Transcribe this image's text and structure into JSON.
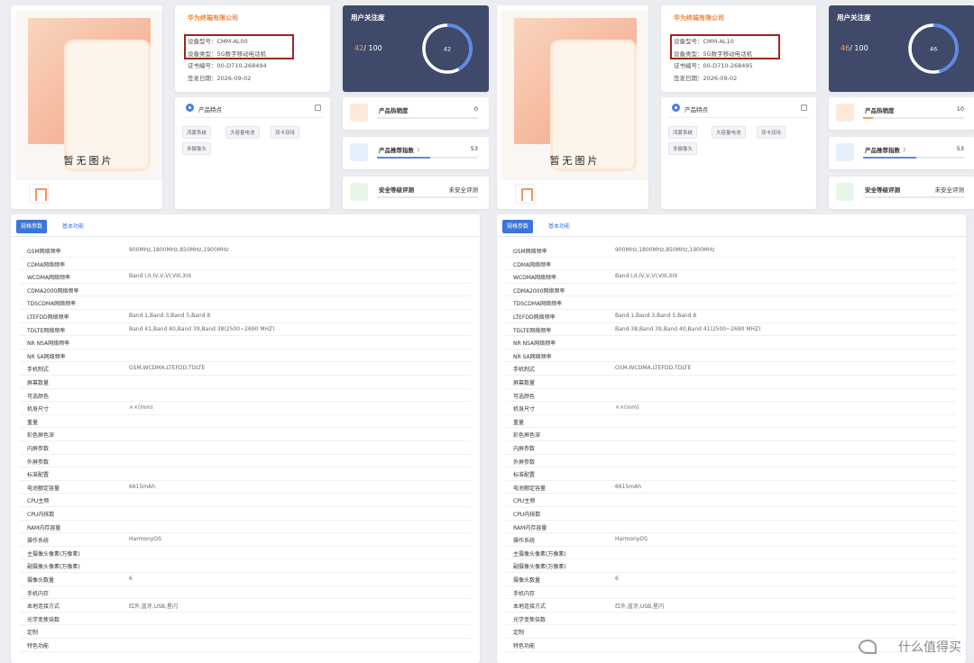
{
  "watermark": "什么值得买",
  "colors": {
    "accent": "#e8843f",
    "highlight_box": "#a3241e",
    "dark_card": "#3f4a6b",
    "ring": "#5b8ae8",
    "tab_active": "#3b76db"
  },
  "panels": [
    {
      "no_image_text": "暂无图片",
      "company": "华为终端有限公司",
      "device_model": "设备型号：CMM-AL00",
      "device_type": "设备类型：5G数字移动电话机",
      "cert_no": "证书编号：00-D710-268494",
      "issue_date": "签发日期：2026-09-02",
      "features_title": "产品特点",
      "feature_tags": [
        "鸿蒙系统",
        "大容量电池",
        "双卡双待",
        "多摄像头"
      ],
      "attention_title": "用户关注度",
      "attention_value": "42",
      "attention_max": "/ 100",
      "attention_ring_label": "42",
      "attention_fraction": 0.42,
      "metrics": [
        {
          "label": "产品热销度",
          "value": "0",
          "icon": "vibrate-phone-icon",
          "fraction": 0.0
        },
        {
          "label": "产品推荐指数",
          "value": "53",
          "icon": "thumbs-up-icon",
          "fraction": 0.53,
          "help": "?"
        },
        {
          "label": "安全等级评测",
          "value": "未安全评测",
          "icon": "shield-icon",
          "fraction": 0
        }
      ],
      "tabs": [
        "规格参数",
        "基本功能"
      ],
      "params": [
        {
          "label": "GSM网络频率",
          "value": "900MHz,1800MHz,850MHz,1900MHz"
        },
        {
          "label": "CDMA网络频率",
          "value": ""
        },
        {
          "label": "WCDMA网络频率",
          "value": "Band I,II,IV,V,VI,VIII,XIX"
        },
        {
          "label": "CDMA2000网络频率",
          "value": ""
        },
        {
          "label": "TDSCDMA网络频率",
          "value": ""
        },
        {
          "label": "LTEFDD网络频率",
          "value": "Band 1,Band 3,Band 5,Band 8"
        },
        {
          "label": "TDLTE网络频率",
          "value": "Band 41,Band 40,Band 39,Band 38(2500~2690 MHZ)"
        },
        {
          "label": "NR NSA网络频率",
          "value": ""
        },
        {
          "label": "NR SA网络频率",
          "value": ""
        },
        {
          "label": "手机制式",
          "value": "GSM,WCDMA,LTEFDD,TDLTE"
        },
        {
          "label": "屏幕数量",
          "value": ""
        },
        {
          "label": "可选颜色",
          "value": ""
        },
        {
          "label": "机身尺寸",
          "value": "××(mm)"
        },
        {
          "label": "重量",
          "value": ""
        },
        {
          "label": "彩色屏色深",
          "value": ""
        },
        {
          "label": "内屏参数",
          "value": ""
        },
        {
          "label": "外屏参数",
          "value": ""
        },
        {
          "label": "标准配置",
          "value": ""
        },
        {
          "label": "电池额定容量",
          "value": "6615mAh"
        },
        {
          "label": "CPU主频",
          "value": ""
        },
        {
          "label": "CPU内核数",
          "value": ""
        },
        {
          "label": "RAM内存容量",
          "value": ""
        },
        {
          "label": "操作系统",
          "value": "HarmonyOS"
        },
        {
          "label": "主摄像头像素(万像素)",
          "value": ""
        },
        {
          "label": "副摄像头像素(万像素)",
          "value": ""
        },
        {
          "label": "摄像头数量",
          "value": "6"
        },
        {
          "label": "手机内存",
          "value": ""
        },
        {
          "label": "本地连接方式",
          "value": "红外,蓝牙,USB,星闪"
        },
        {
          "label": "光学变焦倍数",
          "value": ""
        },
        {
          "label": "定制",
          "value": ""
        },
        {
          "label": "特色功能",
          "value": ""
        }
      ]
    },
    {
      "no_image_text": "暂无图片",
      "company": "华为终端有限公司",
      "device_model": "设备型号：CMM-AL10",
      "device_type": "设备类型：5G数字移动电话机",
      "cert_no": "证书编号：00-D710-268495",
      "issue_date": "签发日期：2026-09-02",
      "features_title": "产品特点",
      "feature_tags": [
        "鸿蒙系统",
        "大容量电池",
        "双卡双待",
        "多摄像头"
      ],
      "attention_title": "用户关注度",
      "attention_value": "46",
      "attention_max": "/ 100",
      "attention_ring_label": "46",
      "attention_fraction": 0.46,
      "metrics": [
        {
          "label": "产品热销度",
          "value": "10",
          "icon": "vibrate-phone-icon",
          "fraction": 0.1
        },
        {
          "label": "产品推荐指数",
          "value": "53",
          "icon": "thumbs-up-icon",
          "fraction": 0.53,
          "help": "?"
        },
        {
          "label": "安全等级评测",
          "value": "未安全评测",
          "icon": "shield-icon",
          "fraction": 0
        }
      ],
      "tabs": [
        "规格参数",
        "基本功能"
      ],
      "params": [
        {
          "label": "GSM网络频率",
          "value": "900MHz,1800MHz,850MHz,1900MHz"
        },
        {
          "label": "CDMA网络频率",
          "value": ""
        },
        {
          "label": "WCDMA网络频率",
          "value": "Band I,II,IV,V,VI,VIII,XIX"
        },
        {
          "label": "CDMA2000网络频率",
          "value": ""
        },
        {
          "label": "TDSCDMA网络频率",
          "value": ""
        },
        {
          "label": "LTEFDD网络频率",
          "value": "Band 1,Band 3,Band 5,Band 8"
        },
        {
          "label": "TDLTE网络频率",
          "value": "Band 38,Band 39,Band 40,Band 41(2500~2690 MHZ)"
        },
        {
          "label": "NR NSA网络频率",
          "value": ""
        },
        {
          "label": "NR SA网络频率",
          "value": ""
        },
        {
          "label": "手机制式",
          "value": "GSM,WCDMA,LTEFDD,TDLTE"
        },
        {
          "label": "屏幕数量",
          "value": ""
        },
        {
          "label": "可选颜色",
          "value": ""
        },
        {
          "label": "机身尺寸",
          "value": "××(mm)"
        },
        {
          "label": "重量",
          "value": ""
        },
        {
          "label": "彩色屏色深",
          "value": ""
        },
        {
          "label": "内屏参数",
          "value": ""
        },
        {
          "label": "外屏参数",
          "value": ""
        },
        {
          "label": "标准配置",
          "value": ""
        },
        {
          "label": "电池额定容量",
          "value": "6615mAh"
        },
        {
          "label": "CPU主频",
          "value": ""
        },
        {
          "label": "CPU内核数",
          "value": ""
        },
        {
          "label": "RAM内存容量",
          "value": ""
        },
        {
          "label": "操作系统",
          "value": "HarmonyOS"
        },
        {
          "label": "主摄像头像素(万像素)",
          "value": ""
        },
        {
          "label": "副摄像头像素(万像素)",
          "value": ""
        },
        {
          "label": "摄像头数量",
          "value": "6"
        },
        {
          "label": "手机内存",
          "value": ""
        },
        {
          "label": "本地连接方式",
          "value": "红外,蓝牙,USB,星闪"
        },
        {
          "label": "光学变焦倍数",
          "value": ""
        },
        {
          "label": "定制",
          "value": ""
        },
        {
          "label": "特色功能",
          "value": ""
        }
      ]
    }
  ]
}
